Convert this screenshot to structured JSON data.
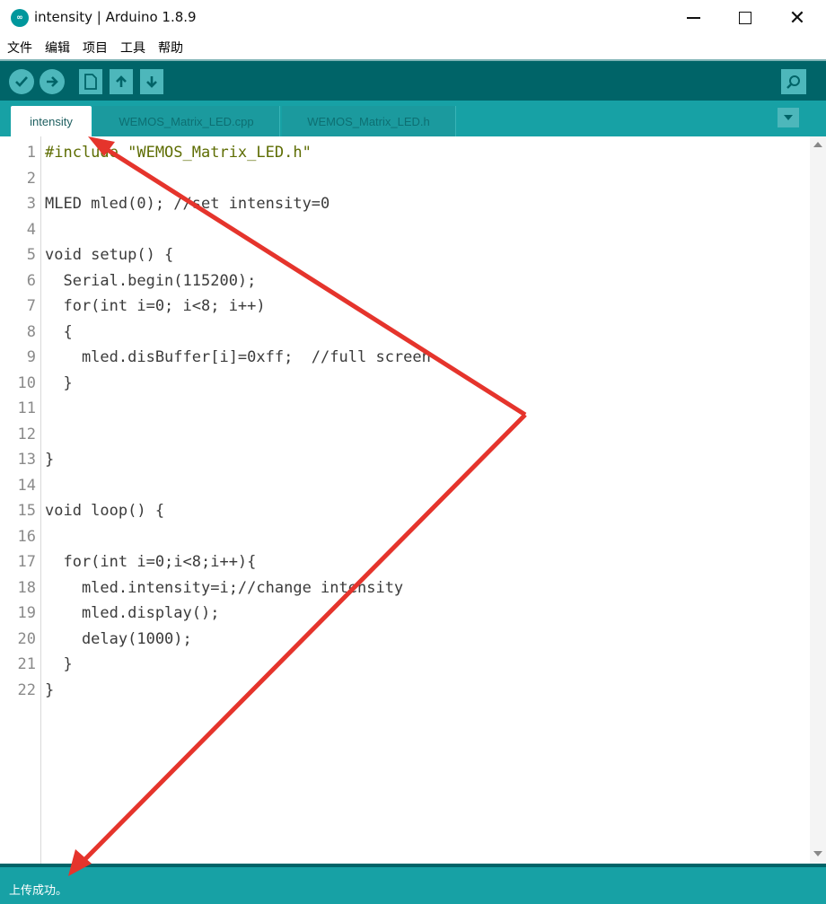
{
  "window": {
    "logo_text": "∞",
    "title": "intensity | Arduino 1.8.9",
    "minimize": "—",
    "close": "✕"
  },
  "menu": [
    "文件",
    "编辑",
    "项目",
    "工具",
    "帮助"
  ],
  "toolbar": {
    "verify_icon": "check-icon",
    "upload_icon": "arrow-right-icon",
    "new_icon": "file-icon",
    "open_icon": "arrow-up-icon",
    "save_icon": "arrow-down-icon",
    "serial_monitor_icon": "magnifier-icon"
  },
  "tabs": [
    "intensity",
    "WEMOS_Matrix_LED.cpp",
    "WEMOS_Matrix_LED.h"
  ],
  "editor": {
    "line_numbers": [
      "1",
      "2",
      "3",
      "4",
      "5",
      "6",
      "7",
      "8",
      "9",
      "10",
      "11",
      "12",
      "13",
      "14",
      "15",
      "16",
      "17",
      "18",
      "19",
      "20",
      "21",
      "22"
    ],
    "lines": [
      "#include \"WEMOS_Matrix_LED.h\"",
      "",
      "MLED mled(0); //set intensity=0",
      "",
      "void setup() {",
      "  Serial.begin(115200);",
      "  for(int i=0; i<8; i++)",
      "  {",
      "    mled.disBuffer[i]=0xff;  //full screen",
      "  }",
      "",
      "",
      "}",
      "",
      "void loop() {",
      "",
      "  for(int i=0;i<8;i++){",
      "    mled.intensity=i;//change intensity",
      "    mled.display();",
      "    delay(1000);",
      "  }",
      "}"
    ]
  },
  "status": {
    "message": "上传成功。"
  },
  "colors": {
    "toolbar": "#006468",
    "tabbar": "#17a1a5",
    "button": "#4db7bb",
    "annotation_arrow": "#e5342c"
  }
}
